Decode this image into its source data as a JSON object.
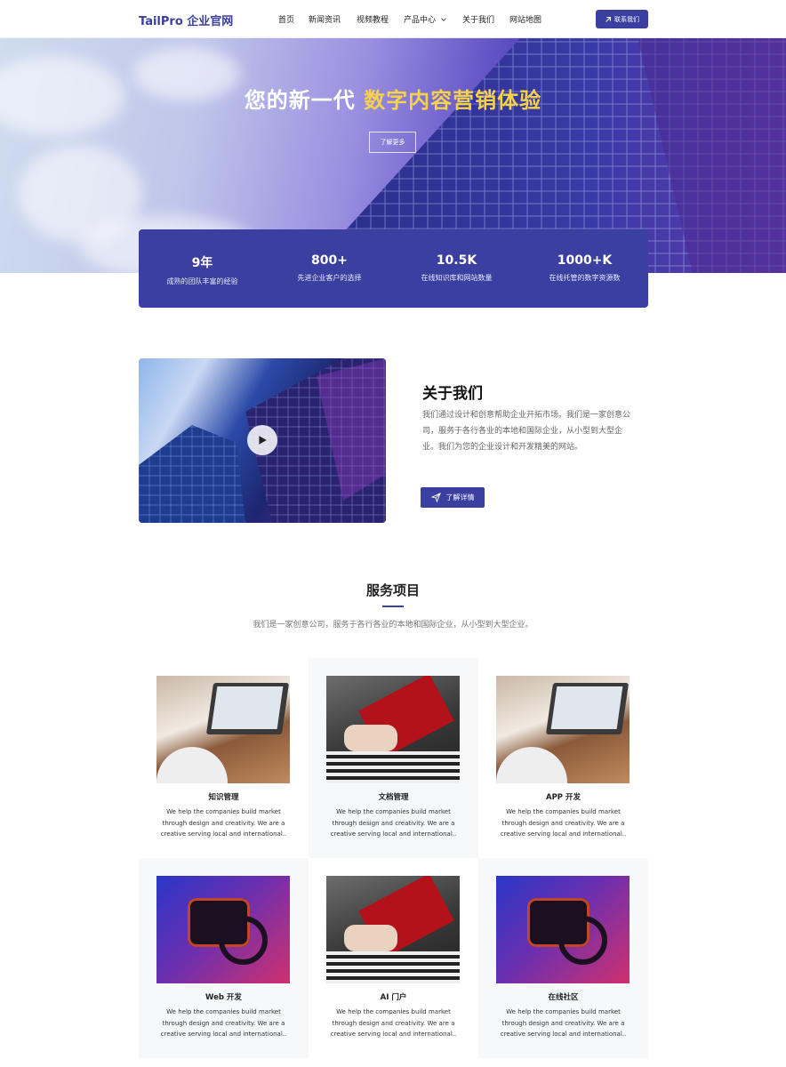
{
  "brand": "TailPro 企业官网",
  "nav": {
    "items": [
      "首页",
      "新闻资讯",
      "视频教程",
      "产品中心",
      "关于我们",
      "网站地图"
    ],
    "contact_label": "联系我们"
  },
  "hero": {
    "title_prefix": "您的新一代",
    "title_highlight": "数字内容营销体验",
    "button_label": "了解更多"
  },
  "stats": [
    {
      "value": "9年",
      "label": "成熟的团队丰富的经验"
    },
    {
      "value": "800+",
      "label": "先进企业客户的选择"
    },
    {
      "value": "10.5K",
      "label": "在线知识库和网站数量"
    },
    {
      "value": "1000+K",
      "label": "在线托管的数字资源数"
    }
  ],
  "about": {
    "title": "关于我们",
    "text": "我们通过设计和创意帮助企业开拓市场。我们是一家创意公司，服务于各行各业的本地和国际企业，从小型到大型企业。我们为您的企业设计和开发精美的网站。",
    "button_label": "了解详情"
  },
  "services": {
    "title": "服务项目",
    "subtitle": "我们是一家创意公司，服务于各行各业的本地和国际企业，从小型到大型企业。",
    "items": [
      {
        "title": "知识管理",
        "desc": "We help the companies build market\nthrough design and creativity. We are a\ncreative serving local and international.."
      },
      {
        "title": "文档管理",
        "desc": "We help the companies build market\nthrough design and creativity. We are a\ncreative serving local and international.."
      },
      {
        "title": "APP 开发",
        "desc": "We help the companies build market\nthrough design and creativity. We are a\ncreative serving local and international.."
      },
      {
        "title": "Web 开发",
        "desc": "We help the companies build market\nthrough design and creativity. We are a\ncreative serving local and international.."
      },
      {
        "title": "AI 门户",
        "desc": "We help the companies build market\nthrough design and creativity. We are a\ncreative serving local and international.."
      },
      {
        "title": "在线社区",
        "desc": "We help the companies build market\nthrough design and creativity. We are a\ncreative serving local and international.."
      }
    ]
  },
  "colors": {
    "brand": "#3b3f9f",
    "highlight": "#f6d24a"
  },
  "icons": {
    "contact": "arrow-up-right-icon",
    "about_button": "paper-plane-icon",
    "video": "play-icon",
    "dropdown": "chevron-down-icon"
  }
}
